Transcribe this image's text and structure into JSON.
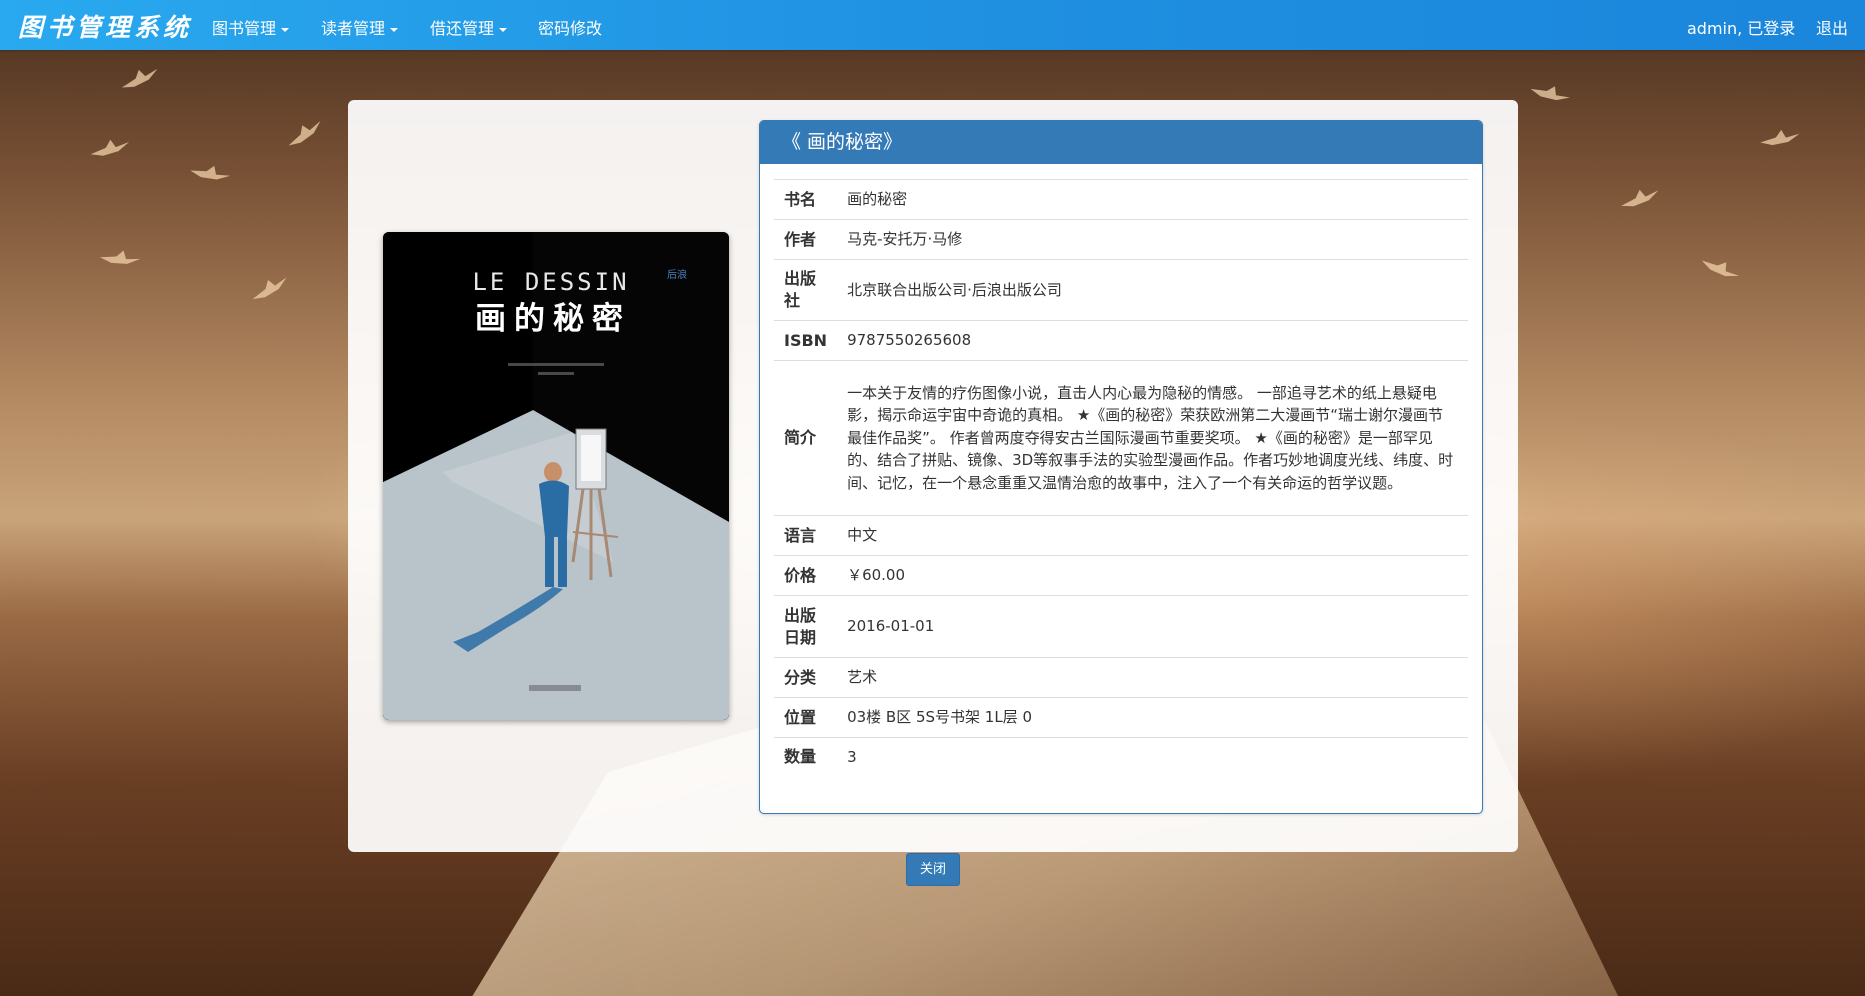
{
  "navbar": {
    "brand": "图书管理系统",
    "menus": [
      {
        "label": "图书管理"
      },
      {
        "label": "读者管理"
      },
      {
        "label": "借还管理"
      }
    ],
    "password_link": "密码修改",
    "user_status": "admin, 已登录",
    "logout": "退出"
  },
  "cover": {
    "title_en": "LE DESSIN",
    "title_cn": "画的秘密",
    "publisher_mark": "后浪"
  },
  "book": {
    "header": "《 画的秘密》",
    "fields": [
      {
        "key": "书名",
        "value": "画的秘密"
      },
      {
        "key": "作者",
        "value": "马克-安托万·马修"
      },
      {
        "key": "出版社",
        "value": "北京联合出版公司·后浪出版公司"
      },
      {
        "key": "ISBN",
        "value": "9787550265608"
      },
      {
        "key": "简介",
        "value": "一本关于友情的疗伤图像小说，直击人内心最为隐秘的情感。 一部追寻艺术的纸上悬疑电影，揭示命运宇宙中奇诡的真相。 ★《画的秘密》荣获欧洲第二大漫画节“瑞士谢尔漫画节最佳作品奖”。 作者曾两度夺得安古兰国际漫画节重要奖项。 ★《画的秘密》是一部罕见的、结合了拼贴、镜像、3D等叙事手法的实验型漫画作品。作者巧妙地调度光线、纬度、时间、记忆，在一个悬念重重又温情治愈的故事中，注入了一个有关命运的哲学议题。"
      },
      {
        "key": "语言",
        "value": "中文"
      },
      {
        "key": "价格",
        "value": "￥60.00"
      },
      {
        "key": "出版日期",
        "value": "2016-01-01"
      },
      {
        "key": "分类",
        "value": "艺术"
      },
      {
        "key": "位置",
        "value": "03楼 B区 5S号书架 1L层 0"
      },
      {
        "key": "数量",
        "value": "3"
      }
    ]
  },
  "close_button": "关闭",
  "colors": {
    "navbar": "#1f8fe0",
    "primary": "#337ab7"
  }
}
